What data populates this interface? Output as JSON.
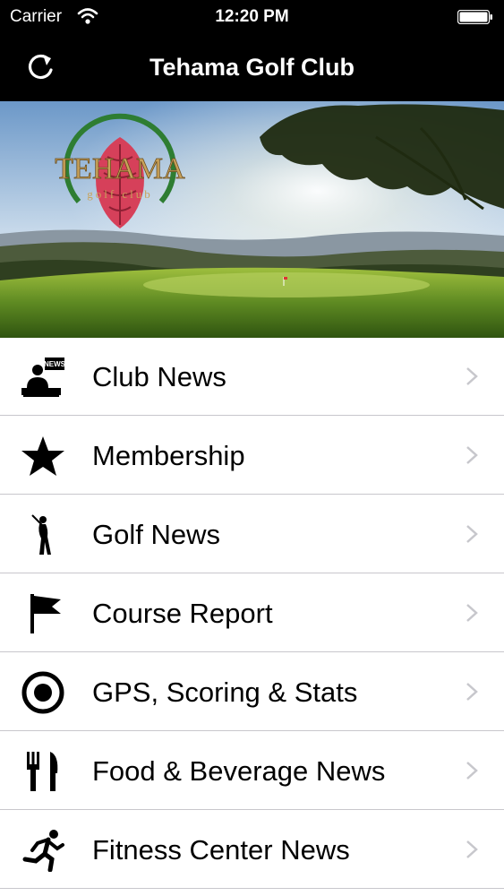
{
  "status": {
    "carrier": "Carrier",
    "time": "12:20 PM"
  },
  "nav": {
    "title": "Tehama Golf Club"
  },
  "hero": {
    "logo_text": "TEHAMA",
    "logo_sub": "golf club"
  },
  "menu": [
    {
      "label": "Club News",
      "icon": "news-icon"
    },
    {
      "label": "Membership",
      "icon": "star-icon"
    },
    {
      "label": "Golf News",
      "icon": "golfer-icon"
    },
    {
      "label": "Course Report",
      "icon": "flag-icon"
    },
    {
      "label": "GPS, Scoring & Stats",
      "icon": "target-icon"
    },
    {
      "label": "Food & Beverage News",
      "icon": "fork-knife-icon"
    },
    {
      "label": "Fitness Center News",
      "icon": "runner-icon"
    }
  ],
  "colors": {
    "bar": "#000000",
    "separator": "#c8c7cc",
    "chevron": "#c7c7cc"
  }
}
